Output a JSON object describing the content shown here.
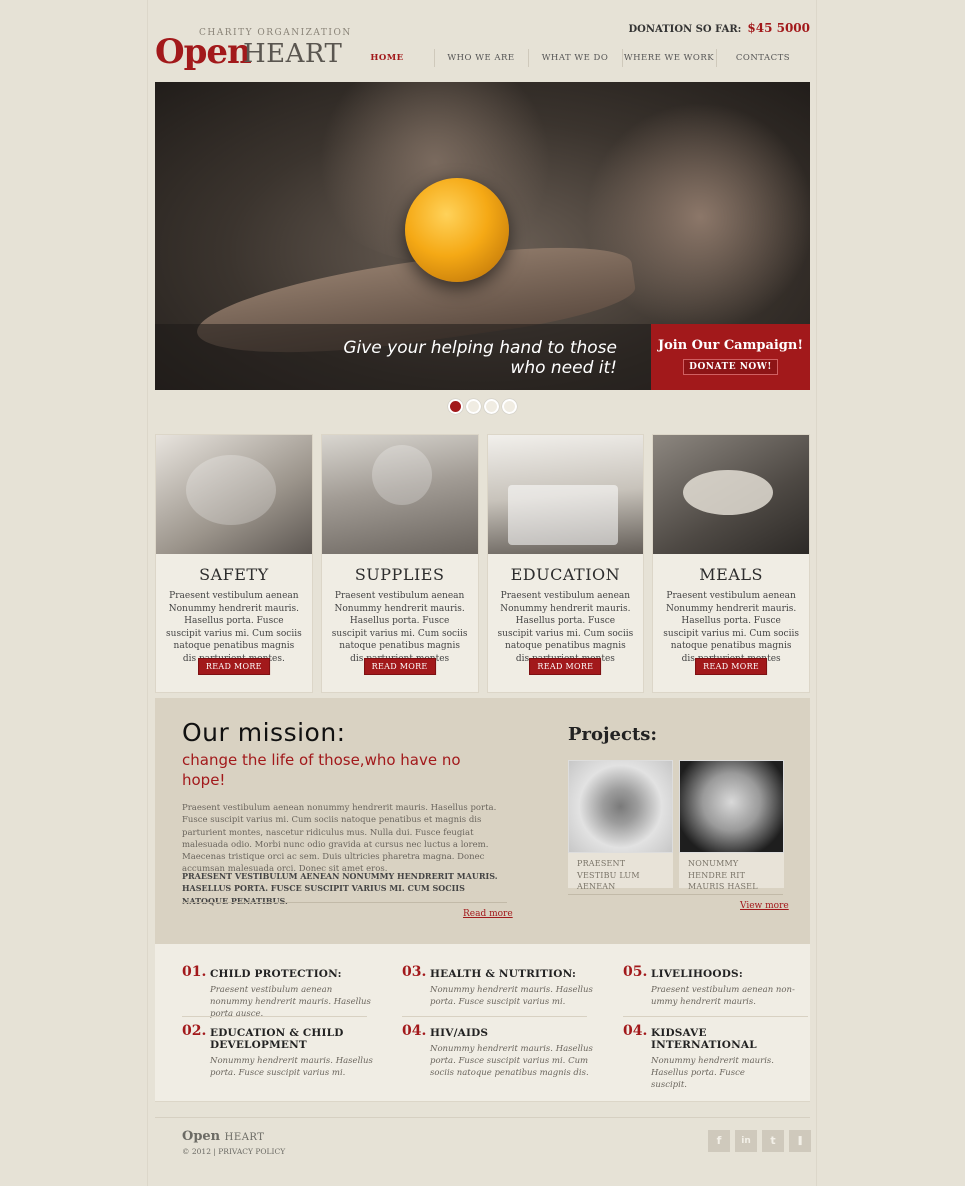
{
  "header": {
    "logo_tagline": "CHARITY ORGANIZATION",
    "logo_open": "Open",
    "logo_heart": "HEART",
    "donation_label": "DONATION SO FAR:",
    "donation_amount": "$45 5000"
  },
  "nav": {
    "items": [
      "HOME",
      "WHO WE ARE",
      "WHAT WE DO",
      "WHERE WE WORK",
      "CONTACTS"
    ],
    "active": "HOME"
  },
  "hero": {
    "slogan_line1": "Give your helping hand to those",
    "slogan_line2": "who need it!",
    "campaign_title": "Join Our Campaign!",
    "donate_button": "DONATE NOW!",
    "slide_count": 4,
    "active_slide": 1
  },
  "cards": [
    {
      "title": "SAFETY",
      "text": "Praesent vestibulum aenean Nonummy hendrerit mauris. Hasellus porta. Fusce suscipit varius mi. Cum sociis natoque penatibus magnis dis parturient montes.",
      "button": "READ MORE"
    },
    {
      "title": "SUPPLIES",
      "text": "Praesent vestibulum aenean Nonummy hendrerit mauris. Hasellus porta. Fusce suscipit varius mi. Cum sociis natoque penatibus magnis dis parturient montes",
      "button": "READ MORE"
    },
    {
      "title": "EDUCATION",
      "text": "Praesent vestibulum aenean Nonummy hendrerit mauris. Hasellus porta. Fusce suscipit varius mi. Cum sociis natoque penatibus magnis dis parturient montes",
      "button": "READ MORE"
    },
    {
      "title": "MEALS",
      "text": "Praesent vestibulum aenean Nonummy hendrerit mauris. Hasellus porta. Fusce suscipit varius mi. Cum sociis natoque penatibus magnis dis parturient montes",
      "button": "READ MORE"
    }
  ],
  "mission": {
    "title": "Our mission:",
    "subtitle": "change the life of those,who have no hope!",
    "body": "Praesent vestibulum aenean nonummy hendrerit mauris. Hasellus porta. Fusce suscipit varius mi. Cum sociis natoque penatibus et magnis dis parturient montes, nascetur ridiculus mus. Nulla dui. Fusce feugiat malesuada odio. Morbi nunc odio gravida at cursus nec luctus a lorem. Maecenas tristique orci ac sem. Duis ultricies pharetra magna. Donec accumsan malesuada orci. Donec sit amet eros.",
    "caps": "PRAESENT VESTIBULUM AENEAN NONUMMY HENDRERIT MAURIS. HASELLUS PORTA. FUSCE SUSCIPIT VARIUS MI. CUM SOCIIS NATOQUE PENATIBUS.",
    "read_more": "Read more"
  },
  "projects": {
    "title": "Projects:",
    "items": [
      {
        "caption": "PRAESENT VESTIBU LUM AENEAN"
      },
      {
        "caption": "NONUMMY HENDRE RIT MAURIS HASEL"
      }
    ],
    "view_more": "View more"
  },
  "services": [
    {
      "num": "01.",
      "title": "CHILD PROTECTION:",
      "desc": "Praesent vestibulum aenean nonummy hendrerit mauris. Hasellus porta ausce."
    },
    {
      "num": "02.",
      "title": "EDUCATION & CHILD DEVELOPMENT",
      "desc": "Nonummy hendrerit mauris. Hasellus porta. Fusce suscipit varius mi."
    },
    {
      "num": "03.",
      "title": "HEALTH & NUTRITION:",
      "desc": "Nonummy hendrerit mauris. Hasellus porta. Fusce suscipit varius mi."
    },
    {
      "num": "04.",
      "title": "HIV/AIDS",
      "desc": "Nonummy hendrerit mauris. Hasellus porta. Fusce suscipit varius mi. Cum sociis natoque penatibus magnis dis."
    },
    {
      "num": "05.",
      "title": "LIVELIHOODS:",
      "desc": "Praesent vestibulum aenean non-ummy hendrerit mauris."
    },
    {
      "num": "04.",
      "title": "KIDSAVE INTERNATIONAL",
      "desc": "Nonummy hendrerit mauris. Hasellus porta. Fusce suscipit."
    }
  ],
  "footer": {
    "logo_open": "Open",
    "logo_heart": "HEART",
    "copyright": "© 2012 | PRIVACY POLICY",
    "social": [
      {
        "icon": "facebook-icon",
        "glyph": "f"
      },
      {
        "icon": "linkedin-icon",
        "glyph": "in"
      },
      {
        "icon": "twitter-icon",
        "glyph": "t"
      },
      {
        "icon": "rss-icon",
        "glyph": "❚"
      }
    ]
  },
  "colors": {
    "accent": "#a2191b",
    "background": "#e6e2d6",
    "panel": "#d9d2c2"
  }
}
